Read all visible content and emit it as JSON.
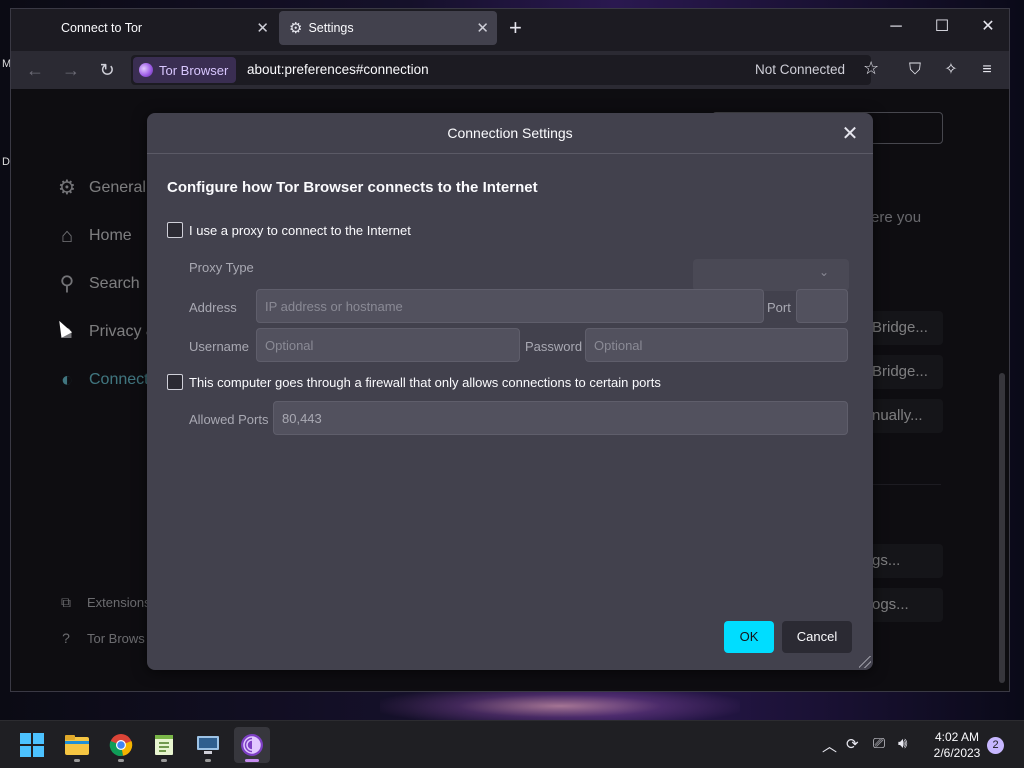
{
  "desktop": {
    "letters": [
      "M",
      "D"
    ]
  },
  "browser": {
    "tabs": [
      {
        "title": "Connect to Tor",
        "active": false
      },
      {
        "title": "Settings",
        "active": true
      }
    ],
    "identity_label": "Tor Browser",
    "url": "about:preferences#connection",
    "status": "Not Connected"
  },
  "settings_page": {
    "sidebar": [
      {
        "label": "General",
        "icon": "gear-icon"
      },
      {
        "label": "Home",
        "icon": "home-icon"
      },
      {
        "label": "Search",
        "icon": "search-icon"
      },
      {
        "label": "Privacy &",
        "icon": "lock-icon"
      },
      {
        "label": "Connect",
        "icon": "tor-onion-icon",
        "active": true
      }
    ],
    "sidebar_footer": [
      {
        "label": "Extensions",
        "icon": "puzzle-icon"
      },
      {
        "label": "Tor Brows",
        "icon": "help-icon"
      }
    ],
    "right_text": "ere you",
    "right_buttons": [
      "Bridge...",
      "Bridge...",
      "nually...",
      "gs...",
      "ogs..."
    ]
  },
  "dialog": {
    "title": "Connection Settings",
    "heading": "Configure how Tor Browser connects to the Internet",
    "proxy_checkbox": {
      "label": "I use a proxy to connect to the Internet",
      "checked": false
    },
    "proxy_type_label": "Proxy Type",
    "address_label": "Address",
    "address_placeholder": "IP address or hostname",
    "port_label": "Port",
    "username_label": "Username",
    "username_placeholder": "Optional",
    "password_label": "Password",
    "password_placeholder": "Optional",
    "firewall_checkbox": {
      "label": "This computer goes through a firewall that only allows connections to certain ports",
      "checked": false
    },
    "allowed_ports_label": "Allowed Ports",
    "allowed_ports_value": "80,443",
    "ok_label": "OK",
    "cancel_label": "Cancel"
  },
  "taskbar": {
    "apps": [
      "windows-start-icon",
      "file-explorer-icon",
      "chrome-icon",
      "notepad-plus-icon",
      "network-tool-icon",
      "tor-browser-icon"
    ],
    "time": "4:02 AM",
    "date": "2/6/2023",
    "notifications": "2"
  },
  "colors": {
    "accent": "#00ddff",
    "active_sidebar": "#80ebff",
    "dialog_bg": "#42414d",
    "tor_purple": "#9f5fe8"
  }
}
